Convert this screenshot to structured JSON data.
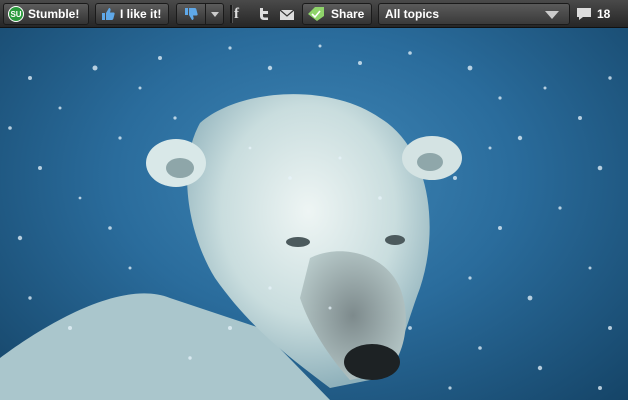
{
  "toolbar": {
    "stumble": {
      "logo": "SU",
      "label": "Stumble!"
    },
    "like": {
      "label": "I like it!"
    },
    "dislike": {
      "icon": "thumb-down-icon",
      "menu_icon": "chevron-down-icon"
    },
    "share_links": [
      {
        "name": "facebook",
        "glyph": "f"
      },
      {
        "name": "twitter",
        "icon": "twitter-icon"
      },
      {
        "name": "email",
        "icon": "mail-icon"
      }
    ],
    "share": {
      "label": "Share"
    },
    "topics": {
      "selected": "All topics"
    },
    "comments": {
      "count": "18"
    }
  },
  "colors": {
    "toolbar_bg": "#2f2f2f",
    "stumble_green": "#2b9a3d",
    "thumb_blue": "#5fa8e8",
    "water_blue": "#2a6c9c"
  }
}
